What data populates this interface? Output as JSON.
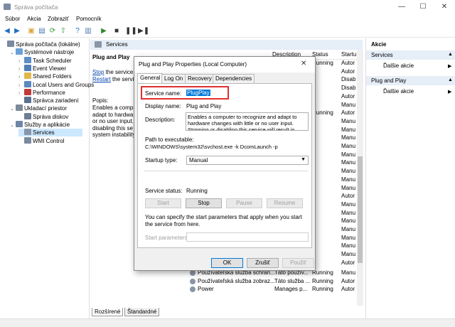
{
  "window": {
    "title": "Správa počítača"
  },
  "menu": [
    "Súbor",
    "Akcia",
    "Zobraziť",
    "Pomocník"
  ],
  "tree": [
    {
      "label": "Správa počítača (lokálne)",
      "level": 0,
      "exp": "",
      "color": "#7a8aa0"
    },
    {
      "label": "Systémové nástroje",
      "level": 1,
      "exp": "⌄",
      "color": "#6aa0d8"
    },
    {
      "label": "Task Scheduler",
      "level": 2,
      "exp": "›",
      "color": "#5b8fc7"
    },
    {
      "label": "Event Viewer",
      "level": 2,
      "exp": "›",
      "color": "#4f7fb8"
    },
    {
      "label": "Shared Folders",
      "level": 2,
      "exp": "›",
      "color": "#e2b74a"
    },
    {
      "label": "Local Users and Groups",
      "level": 2,
      "exp": "›",
      "color": "#5a88c0"
    },
    {
      "label": "Performance",
      "level": 2,
      "exp": "›",
      "color": "#c23a3a"
    },
    {
      "label": "Správca zariadení",
      "level": 2,
      "exp": "",
      "color": "#5a7090"
    },
    {
      "label": "Ukladací priestor",
      "level": 1,
      "exp": "⌄",
      "color": "#7d8a99"
    },
    {
      "label": "Správa diskov",
      "level": 2,
      "exp": "",
      "color": "#6d7f95"
    },
    {
      "label": "Služby a aplikácie",
      "level": 1,
      "exp": "⌄",
      "color": "#6f86a6"
    },
    {
      "label": "Services",
      "level": 2,
      "exp": "",
      "color": "#8896a8",
      "selected": true
    },
    {
      "label": "WMI Control",
      "level": 2,
      "exp": "",
      "color": "#7a8a9c"
    }
  ],
  "center": {
    "header": "Services",
    "service_name": "Plug and Play",
    "stop_link": "Stop",
    "stop_rest": " the service",
    "restart_link": "Restart",
    "restart_rest": " the service",
    "desc_label": "Popis:",
    "desc_lines": [
      "Enables a compu",
      "adapt to hardwa",
      "or no user input.",
      "disabling this se",
      "system instability"
    ],
    "col_status": "Status",
    "col_startup": "Startu",
    "col_desc": "Description",
    "rows_top": [
      {
        "status": "Running",
        "startup": "Autor"
      },
      {
        "status": "",
        "startup": "Autor"
      },
      {
        "status": "",
        "startup": "Disab"
      },
      {
        "status": "",
        "startup": "Disab"
      },
      {
        "status": "",
        "startup": "Autor"
      },
      {
        "status": "",
        "startup": "Manu"
      },
      {
        "status": "Running",
        "startup": "Autor"
      },
      {
        "status": "",
        "startup": "Manu"
      },
      {
        "status": "",
        "startup": "Manu"
      },
      {
        "status": "",
        "startup": "Manu"
      },
      {
        "status": "",
        "startup": "Manu"
      },
      {
        "status": "",
        "startup": "Manu"
      },
      {
        "status": "",
        "startup": "Manu"
      },
      {
        "status": "",
        "startup": "Manu"
      },
      {
        "status": "",
        "startup": "Manu"
      },
      {
        "status": "",
        "startup": "Manu"
      },
      {
        "status": "",
        "startup": "Autor"
      },
      {
        "status": "",
        "startup": "Manu"
      },
      {
        "status": "",
        "startup": "Manu"
      },
      {
        "status": "",
        "startup": "Manu"
      },
      {
        "status": "",
        "startup": "Manu"
      },
      {
        "status": "",
        "startup": "Manu"
      },
      {
        "status": "",
        "startup": "Manu"
      },
      {
        "status": "",
        "startup": "Manu"
      },
      {
        "status": "",
        "startup": "Autor"
      }
    ],
    "rows_bottom": [
      {
        "name": "Používateľská služba schrán...",
        "desc": "Táto použív...",
        "status": "Running",
        "startup": "Manu"
      },
      {
        "name": "Používateľská služba zobraz...",
        "desc": "Táto služba ...",
        "status": "Running",
        "startup": "Autor"
      },
      {
        "name": "Power",
        "desc": "Manages p...",
        "status": "Running",
        "startup": "Autor"
      }
    ],
    "tab_extended": "Rozšírené",
    "tab_standard": "Štandardné"
  },
  "actions": {
    "header": "Akcie",
    "groups": [
      {
        "title": "Services",
        "item": "Ďalšie akcie"
      },
      {
        "title": "Plug and Play",
        "item": "Ďalšie akcie"
      }
    ]
  },
  "dialog": {
    "title": "Plug and Play Properties (Local Computer)",
    "tabs": [
      "General",
      "Log On",
      "Recovery",
      "Dependencies"
    ],
    "service_name_label": "Service name:",
    "service_name_value": "PlugPlay",
    "display_name_label": "Display name:",
    "display_name_value": "Plug and Play",
    "description_label": "Description:",
    "description_text": "Enables a computer to recognize and adapt to hardware changes with little or no user input. Stopping or disabling this service will result in system",
    "path_label": "Path to executable:",
    "path_value": "C:\\WINDOWS\\system32\\svchost.exe -k DcomLaunch -p",
    "startup_label": "Startup type:",
    "startup_value": "Manual",
    "status_label": "Service status:",
    "status_value": "Running",
    "btn_start": "Start",
    "btn_stop": "Stop",
    "btn_pause": "Pause",
    "btn_resume": "Resume",
    "hint": "You can specify the start parameters that apply when you start the service from here.",
    "start_params_label": "Start parameters:",
    "btn_ok": "OK",
    "btn_cancel": "Zrušiť",
    "btn_apply": "Použiť"
  },
  "colors": {
    "highlight": "#e03030",
    "selection": "#0078d7",
    "header_bg": "#e6eef8"
  }
}
